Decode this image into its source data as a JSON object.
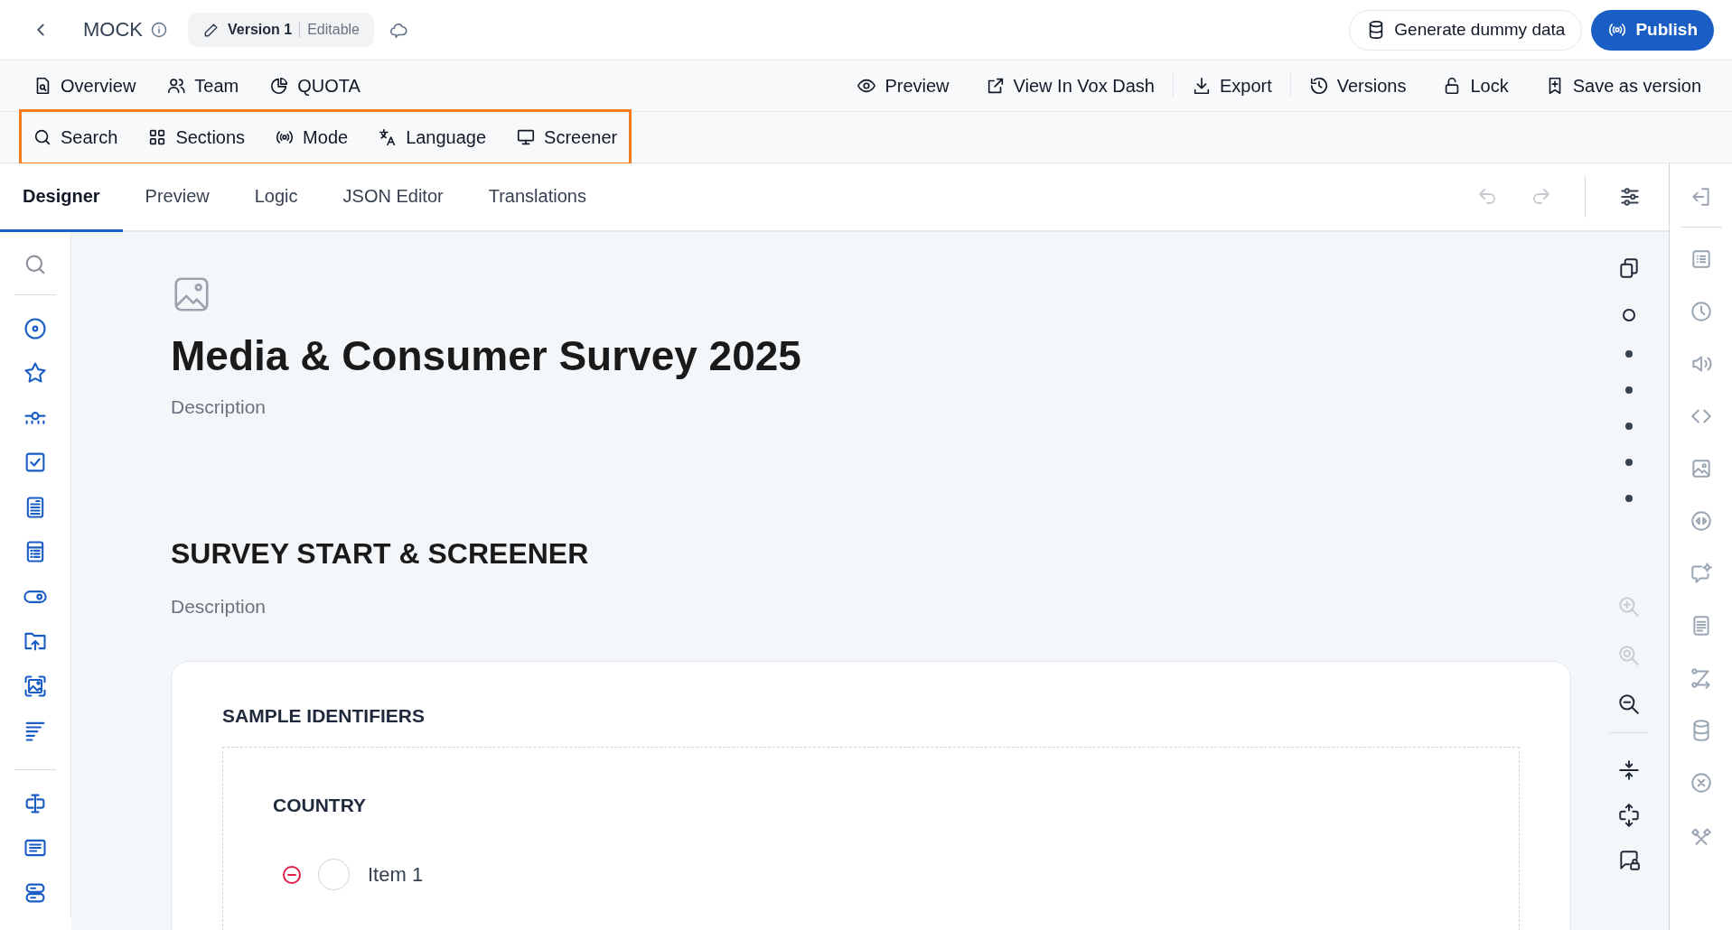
{
  "header": {
    "title": "MOCK",
    "version": {
      "label": "Version 1",
      "status": "Editable"
    },
    "actions": [
      {
        "label": "Generate dummy data",
        "kind": "secondary"
      },
      {
        "label": "Publish",
        "kind": "primary"
      }
    ]
  },
  "nav": {
    "left": [
      {
        "label": "Overview"
      },
      {
        "label": "Team"
      },
      {
        "label": "QUOTA"
      }
    ],
    "right": [
      {
        "label": "Preview",
        "divider_after": false
      },
      {
        "label": "View In Vox Dash",
        "divider_after": true
      },
      {
        "label": "Export",
        "divider_after": true
      },
      {
        "label": "Versions",
        "divider_after": false
      },
      {
        "label": "Lock",
        "divider_after": false
      },
      {
        "label": "Save as version",
        "divider_after": false
      }
    ]
  },
  "toolbar": {
    "highlighted": true,
    "items": [
      {
        "label": "Search"
      },
      {
        "label": "Sections"
      },
      {
        "label": "Mode"
      },
      {
        "label": "Language"
      },
      {
        "label": "Screener"
      }
    ]
  },
  "tabs": [
    {
      "label": "Designer",
      "selected": true
    },
    {
      "label": "Preview",
      "selected": false
    },
    {
      "label": "Logic",
      "selected": false
    },
    {
      "label": "JSON Editor",
      "selected": false
    },
    {
      "label": "Translations",
      "selected": false
    }
  ],
  "history": {
    "undo": {
      "disabled": true
    },
    "redo": {
      "disabled": true
    }
  },
  "survey": {
    "title": "Media & Consumer Survey 2025",
    "description": "Description",
    "page": {
      "title": "SURVEY START & SCREENER",
      "description": "Description",
      "panel": {
        "title": "SAMPLE IDENTIFIERS",
        "question": {
          "title": "COUNTRY",
          "choices": [
            {
              "label": "Item 1",
              "checked": false
            }
          ]
        }
      }
    }
  },
  "tools": {
    "section_markers": [
      {
        "selected": true
      },
      {
        "selected": false
      },
      {
        "selected": false
      },
      {
        "selected": false
      },
      {
        "selected": false
      },
      {
        "selected": false
      }
    ],
    "zoom": [
      {
        "disabled": true
      },
      {
        "disabled": true
      },
      {
        "disabled": false
      }
    ]
  }
}
